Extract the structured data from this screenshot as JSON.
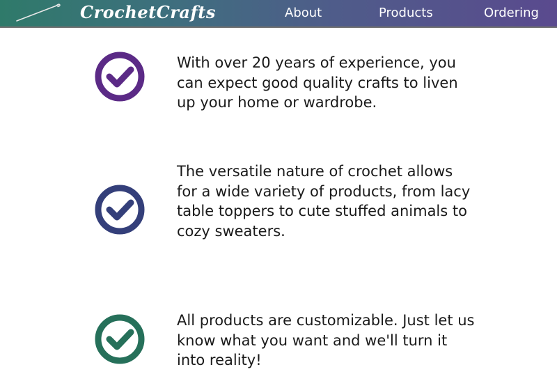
{
  "nav": {
    "brand": "CrochetCrafts",
    "links": [
      "About",
      "Products",
      "Ordering"
    ],
    "logo_icon": "crochet-hook-icon"
  },
  "features": [
    {
      "icon": "check-circle-icon",
      "color": "#5b2a86",
      "text": "With over 20 years of experience, you can expect good quality crafts to liven up your home or wardrobe."
    },
    {
      "icon": "check-circle-icon",
      "color": "#343f7a",
      "text": "The versatile nature of crochet allows for a wide variety of products, from lacy table toppers to cute stuffed animals to cozy sweaters."
    },
    {
      "icon": "check-circle-icon",
      "color": "#26705a",
      "text": "All products are customizable. Just let us know what you want and we'll turn it into reality!"
    }
  ]
}
